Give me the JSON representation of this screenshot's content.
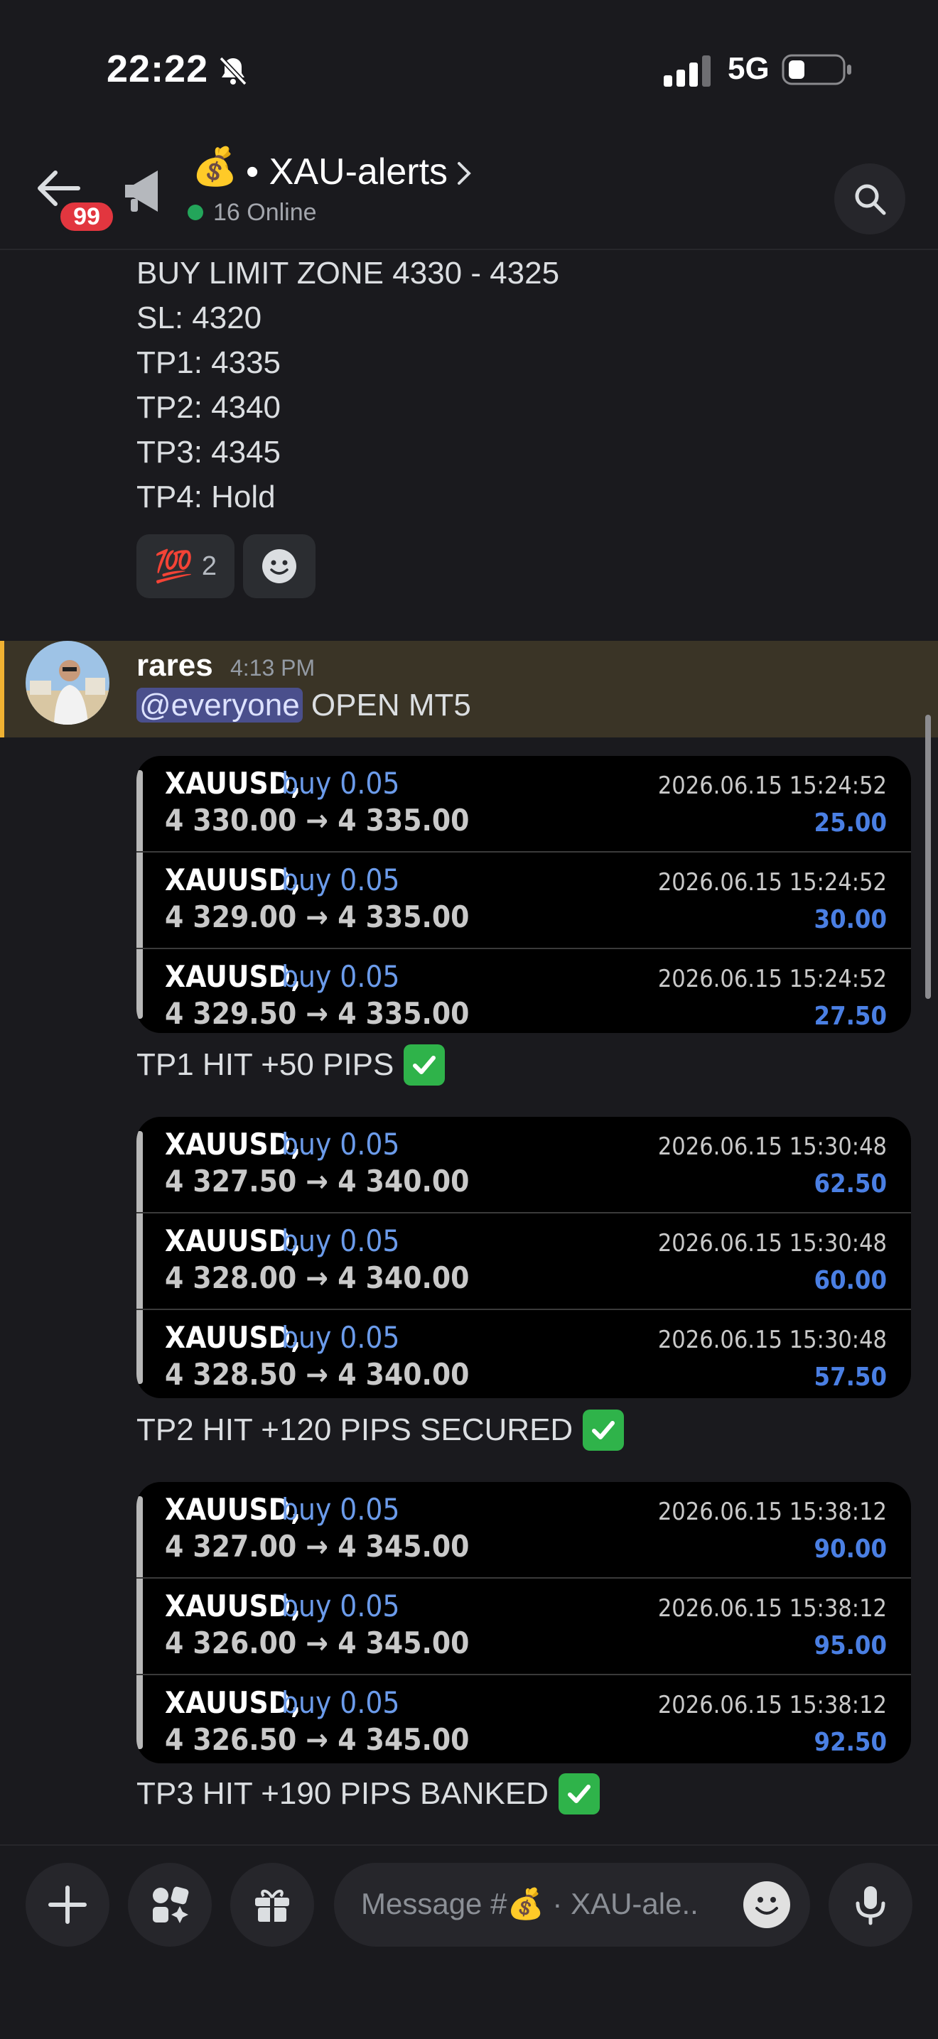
{
  "status_bar": {
    "time": "22:22",
    "network": "5G"
  },
  "header": {
    "unread_badge": "99",
    "channel_emoji": "💰",
    "channel_name": "• XAU-alerts",
    "online": "16 Online"
  },
  "signal_message": {
    "lines": [
      "BUY LIMIT ZONE 4330 - 4325",
      "SL: 4320",
      "TP1: 4335",
      "TP2: 4340",
      "TP3: 4345",
      "TP4: Hold"
    ],
    "reaction_emoji": "💯",
    "reaction_count": "2"
  },
  "mention_message": {
    "author": "rares",
    "time": "4:13 PM",
    "mention": "@everyone",
    "text": " OPEN MT5"
  },
  "trade_groups": [
    {
      "trades": [
        {
          "symbol": "XAUUSD,",
          "side": "buy 0.05",
          "prices": "4 330.00 → 4 335.00",
          "date": "2026.06.15 15:24:52",
          "profit": "25.00"
        },
        {
          "symbol": "XAUUSD,",
          "side": "buy 0.05",
          "prices": "4 329.00 → 4 335.00",
          "date": "2026.06.15 15:24:52",
          "profit": "30.00"
        },
        {
          "symbol": "XAUUSD,",
          "side": "buy 0.05",
          "prices": "4 329.50 → 4 335.00",
          "date": "2026.06.15 15:24:52",
          "profit": "27.50"
        }
      ],
      "caption": "TP1 HIT +50 PIPS"
    },
    {
      "trades": [
        {
          "symbol": "XAUUSD,",
          "side": "buy 0.05",
          "prices": "4 327.50 → 4 340.00",
          "date": "2026.06.15 15:30:48",
          "profit": "62.50"
        },
        {
          "symbol": "XAUUSD,",
          "side": "buy 0.05",
          "prices": "4 328.00 → 4 340.00",
          "date": "2026.06.15 15:30:48",
          "profit": "60.00"
        },
        {
          "symbol": "XAUUSD,",
          "side": "buy 0.05",
          "prices": "4 328.50 → 4 340.00",
          "date": "2026.06.15 15:30:48",
          "profit": "57.50"
        }
      ],
      "caption": "TP2 HIT +120 PIPS SECURED"
    },
    {
      "trades": [
        {
          "symbol": "XAUUSD,",
          "side": "buy 0.05",
          "prices": "4 327.00 → 4 345.00",
          "date": "2026.06.15 15:38:12",
          "profit": "90.00"
        },
        {
          "symbol": "XAUUSD,",
          "side": "buy 0.05",
          "prices": "4 326.00 → 4 345.00",
          "date": "2026.06.15 15:38:12",
          "profit": "95.00"
        },
        {
          "symbol": "XAUUSD,",
          "side": "buy 0.05",
          "prices": "4 326.50 → 4 345.00",
          "date": "2026.06.15 15:38:12",
          "profit": "92.50"
        }
      ],
      "caption": "TP3 HIT +190 PIPS BANKED"
    }
  ],
  "composer": {
    "placeholder": "Message #💰 · XAU-ale.."
  },
  "colors": {
    "accent_blue": "#6b9bea",
    "profit_blue": "#4a7fe3",
    "mention_bg": "#3a3426",
    "mention_bar": "#f0b232",
    "online_green": "#23a55a",
    "badge_red": "#e2363f",
    "check_green": "#2fb34a"
  },
  "icons": [
    "mute-bell-icon",
    "signal-icon",
    "battery-icon",
    "back-arrow-icon",
    "megaphone-icon",
    "chevron-right-icon",
    "search-icon",
    "plus-icon",
    "apps-icon",
    "gift-icon",
    "emoji-icon",
    "microphone-icon",
    "checkmark-icon",
    "smiley-add-reaction-icon"
  ]
}
